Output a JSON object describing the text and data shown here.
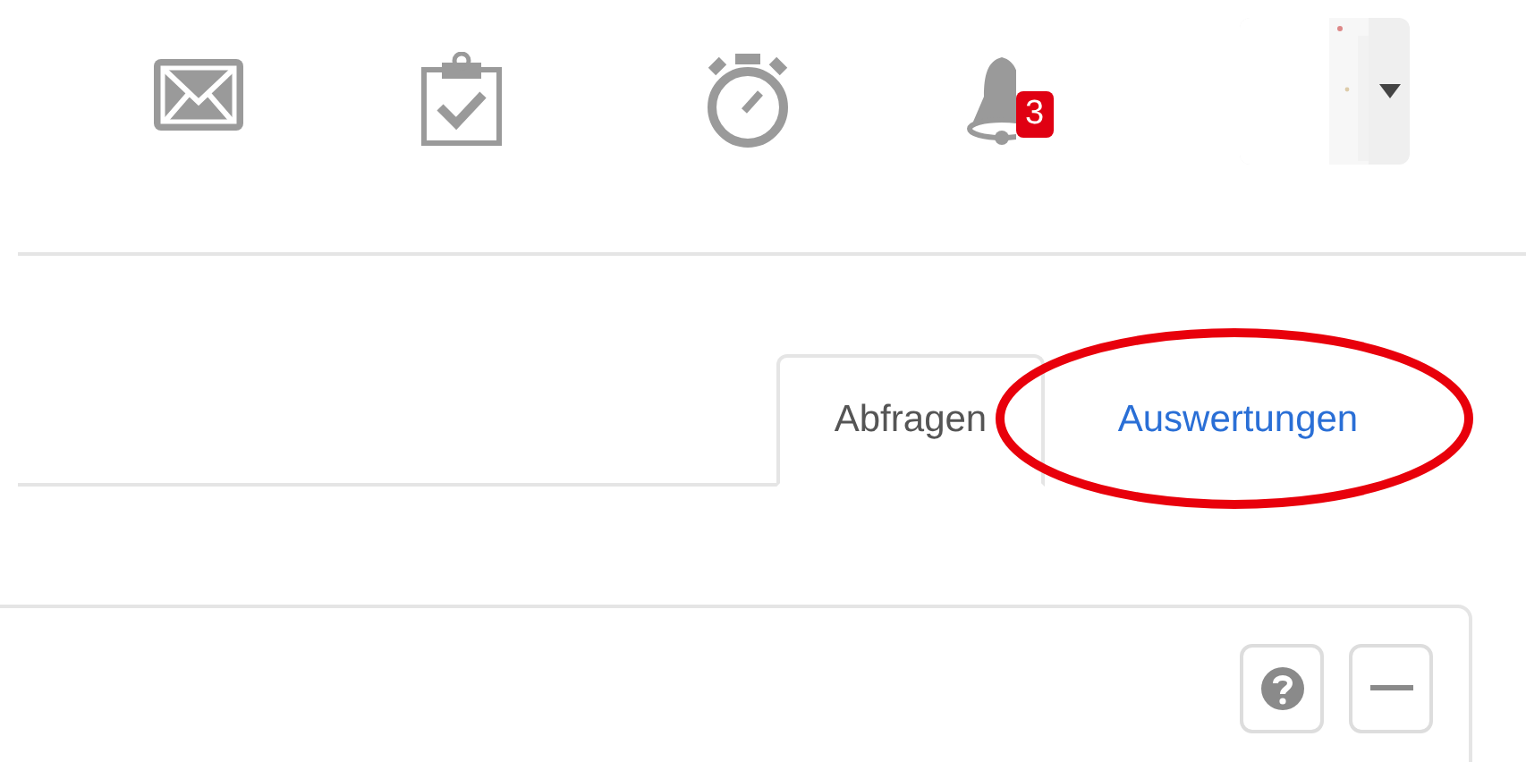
{
  "header": {
    "notification_count": "3"
  },
  "tabs": [
    {
      "label": "Abfragen",
      "selected": true,
      "circled": false
    },
    {
      "label": "Auswertungen",
      "selected": false,
      "circled": true
    }
  ]
}
